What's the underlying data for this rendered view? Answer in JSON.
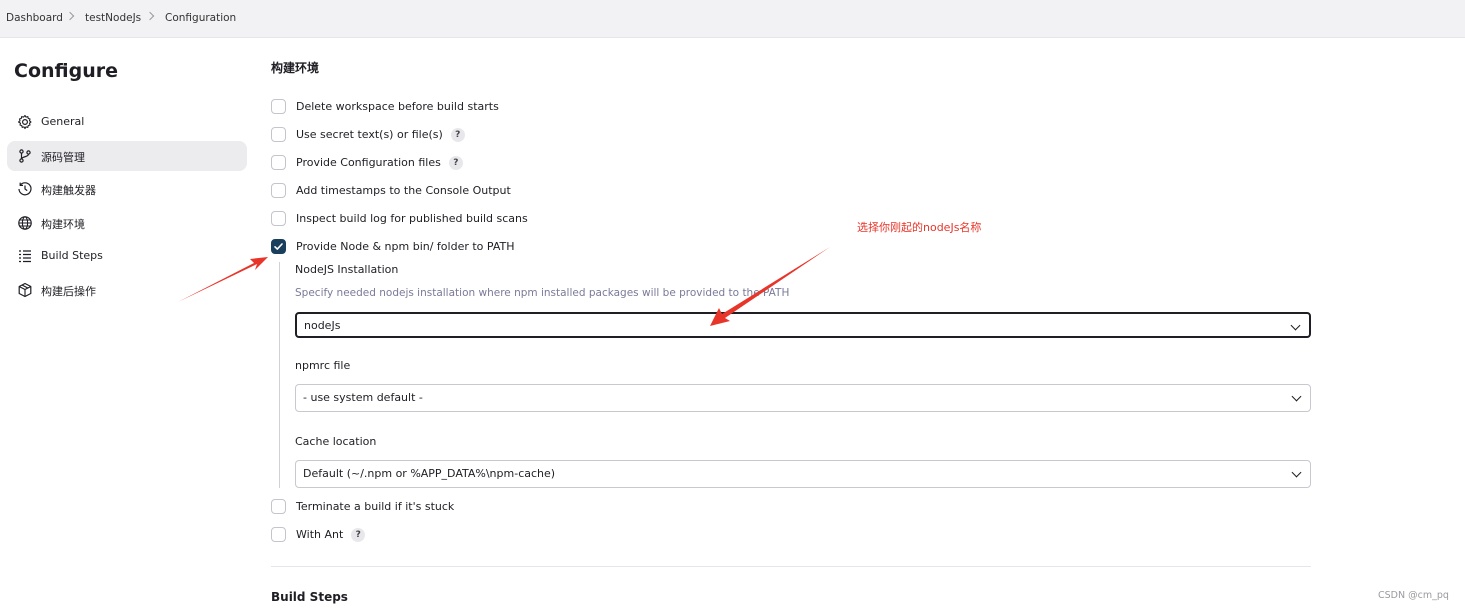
{
  "breadcrumb": {
    "items": [
      "Dashboard",
      "testNodeJs",
      "Configuration"
    ]
  },
  "sidebar": {
    "title": "Configure",
    "active_index": 1,
    "items": [
      {
        "label": "General",
        "icon": "gear-icon"
      },
      {
        "label": "源码管理",
        "icon": "git-branch-icon"
      },
      {
        "label": "构建触发器",
        "icon": "clock-icon"
      },
      {
        "label": "构建环境",
        "icon": "globe-icon"
      },
      {
        "label": "Build Steps",
        "icon": "list-icon"
      },
      {
        "label": "构建后操作",
        "icon": "cube-icon"
      }
    ]
  },
  "build_env": {
    "title": "构建环境",
    "options": [
      {
        "label": "Delete workspace before build starts",
        "checked": false,
        "help": false
      },
      {
        "label": "Use secret text(s) or file(s)",
        "checked": false,
        "help": true
      },
      {
        "label": "Provide Configuration files",
        "checked": false,
        "help": true
      },
      {
        "label": "Add timestamps to the Console Output",
        "checked": false,
        "help": false
      },
      {
        "label": "Inspect build log for published build scans",
        "checked": false,
        "help": false
      },
      {
        "label": "Provide Node & npm bin/ folder to PATH",
        "checked": true,
        "help": false
      }
    ],
    "node": {
      "installation_label": "NodeJS Installation",
      "installation_desc": "Specify needed nodejs installation where npm installed packages will be provided to the PATH",
      "installation_value": "nodeJs",
      "npmrc_label": "npmrc file",
      "npmrc_value": "- use system default -",
      "cache_label": "Cache location",
      "cache_value": "Default (~/.npm or %APP_DATA%\\npm-cache)"
    },
    "options_after": [
      {
        "label": "Terminate a build if it's stuck",
        "checked": false,
        "help": false
      },
      {
        "label": "With Ant",
        "checked": false,
        "help": true
      }
    ]
  },
  "help_glyph": "?",
  "build_steps": {
    "title": "Build Steps"
  },
  "annotation": {
    "text": "选择你刚起的nodeJs名称",
    "color": "#e8352a"
  },
  "watermark": "CSDN @cm_pq",
  "colors": {
    "checkbox_checked": "#1a3f5c",
    "desc_text": "#7a7a99",
    "arrow": "#e8352a"
  }
}
